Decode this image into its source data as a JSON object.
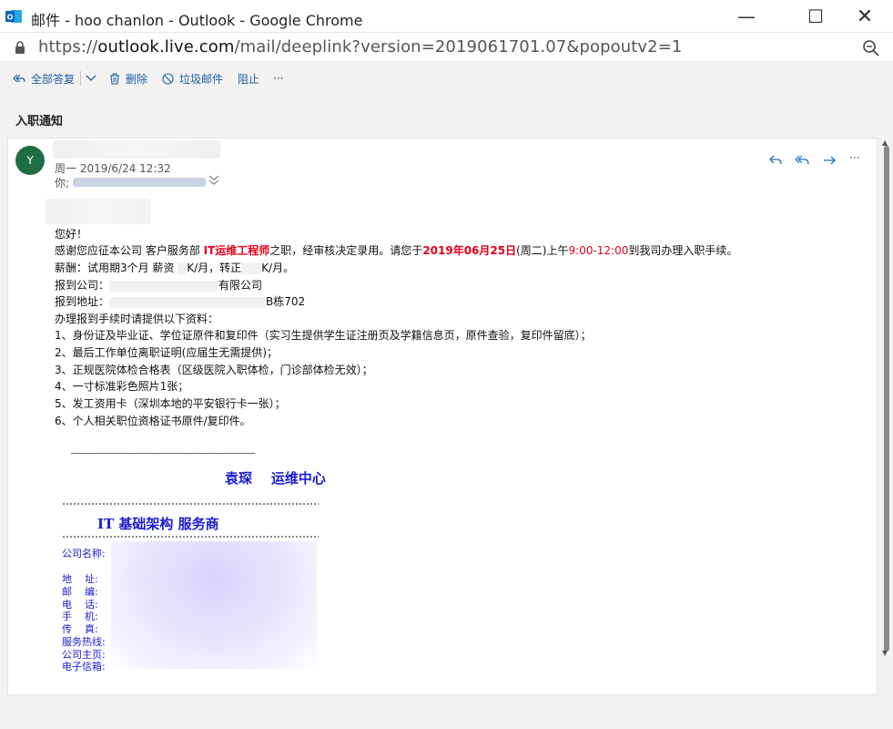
{
  "window": {
    "title": "邮件 - hoo chanlon - Outlook - Google Chrome",
    "minimize": "—",
    "maximize": "☐",
    "close": "✕"
  },
  "address": {
    "url_prefix": "https://",
    "url_host": "outlook.live.com",
    "url_path": "/mail/deeplink?version=2019061701.07&popoutv2=1"
  },
  "toolbar": {
    "reply_all": "全部答复",
    "delete": "删除",
    "junk": "垃圾邮件",
    "block": "阻止",
    "more": "···"
  },
  "message": {
    "subject": "入职通知",
    "avatar_initial": "Y",
    "date": "周一 2019/6/24 12:32",
    "to_label": "你;",
    "more": "···"
  },
  "body": {
    "greeting": "您好！",
    "line1_a": "感谢您应征本公司 客户服务部 ",
    "line1_role": "IT运维工程师",
    "line1_b": "之职，经审核决定录用。请您于",
    "line1_date": "2019年06月25日",
    "line1_c": "(周二)上午",
    "line1_time": "9:00-12:00",
    "line1_d": "到我司办理入职手续。",
    "salary_a": "薪酬：试用期3个月 薪资 ",
    "salary_b": "K/月，转正",
    "salary_c": "K/月。",
    "company_label": "报到公司：",
    "company_suffix": "有限公司",
    "address_label": "报到地址：",
    "address_suffix": "B栋702",
    "materials_intro": "办理报到手续时请提供以下资料：",
    "item1": "1、身份证及毕业证、学位证原件和复印件（实习生提供学生证注册页及学籍信息页，原件查验，复印件留底）；",
    "item2": "2、最后工作单位离职证明(应届生无需提供)；",
    "item3": "3、正规医院体检合格表（区级医院入职体检，门诊部体检无效）；",
    "item4": "4、一寸标准彩色照片1张；",
    "item5": "5、发工资用卡（深圳本地的平安银行卡一张）；",
    "item6": "6、个人相关职位资格证书原件/复印件。"
  },
  "signature": {
    "dashes": "————————————————————————————",
    "name_line": "袁琛    运维中心",
    "company": "IT 基础架构 服务商",
    "labels": [
      "公司名称:",
      "地    址:",
      "邮    编:",
      "电    话:",
      "手    机:",
      "传    真:",
      "服务热线:",
      "公司主页:",
      "电子信箱:"
    ]
  }
}
